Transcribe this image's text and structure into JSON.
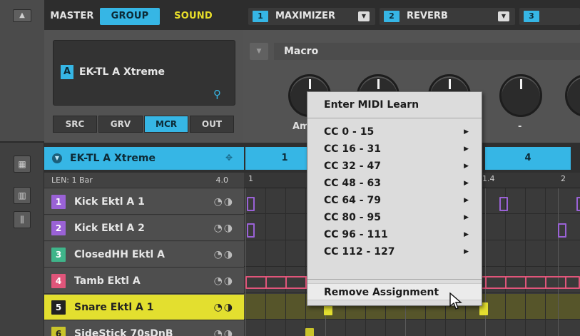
{
  "topbar": {
    "tabs": [
      "MASTER",
      "GROUP",
      "SOUND"
    ],
    "slots": [
      {
        "num": "1",
        "name": "MAXIMIZER"
      },
      {
        "num": "2",
        "name": "REVERB"
      },
      {
        "num": "3",
        "name": ""
      }
    ]
  },
  "group": {
    "letter": "A",
    "name": "EK-TL A Xtreme",
    "modes": [
      "SRC",
      "GRV",
      "MCR",
      "OUT"
    ],
    "active_mode": "MCR"
  },
  "macro": {
    "title": "Macro",
    "knob_labels": [
      "Am",
      "",
      "",
      "-",
      ""
    ]
  },
  "pattern": {
    "group_name": "EK-TL A Xtreme",
    "cells": [
      "1",
      "4"
    ],
    "len_label": "LEN: 1 Bar",
    "len_value": "4.0",
    "ruler": [
      "1",
      "1.4",
      "2"
    ]
  },
  "sounds": [
    {
      "num": "1",
      "name": "Kick Ektl A 1",
      "color": "#9a62d6"
    },
    {
      "num": "2",
      "name": "Kick Ektl A 2",
      "color": "#9a62d6"
    },
    {
      "num": "3",
      "name": "ClosedHH Ektl A",
      "color": "#3fb58a"
    },
    {
      "num": "4",
      "name": "Tamb Ektl A",
      "color": "#e0557a"
    },
    {
      "num": "5",
      "name": "Snare Ektl A 1",
      "color": "#222222"
    },
    {
      "num": "6",
      "name": "SideStick 70sDnB",
      "color": "#c9c42a"
    }
  ],
  "context_menu": {
    "header": "Enter MIDI Learn",
    "submenus": [
      "CC 0 - 15",
      "CC 16 - 31",
      "CC 32 - 47",
      "CC 48 - 63",
      "CC 64 - 79",
      "CC 80 - 95",
      "CC 96 - 111",
      "CC 112 - 127"
    ],
    "footer": "Remove Assignment"
  },
  "colors": {
    "accent": "#36b6e5",
    "sound": "#e8de2a",
    "purple": "#9a62d6",
    "pink": "#e0557a",
    "yellow": "#e3df2f"
  }
}
